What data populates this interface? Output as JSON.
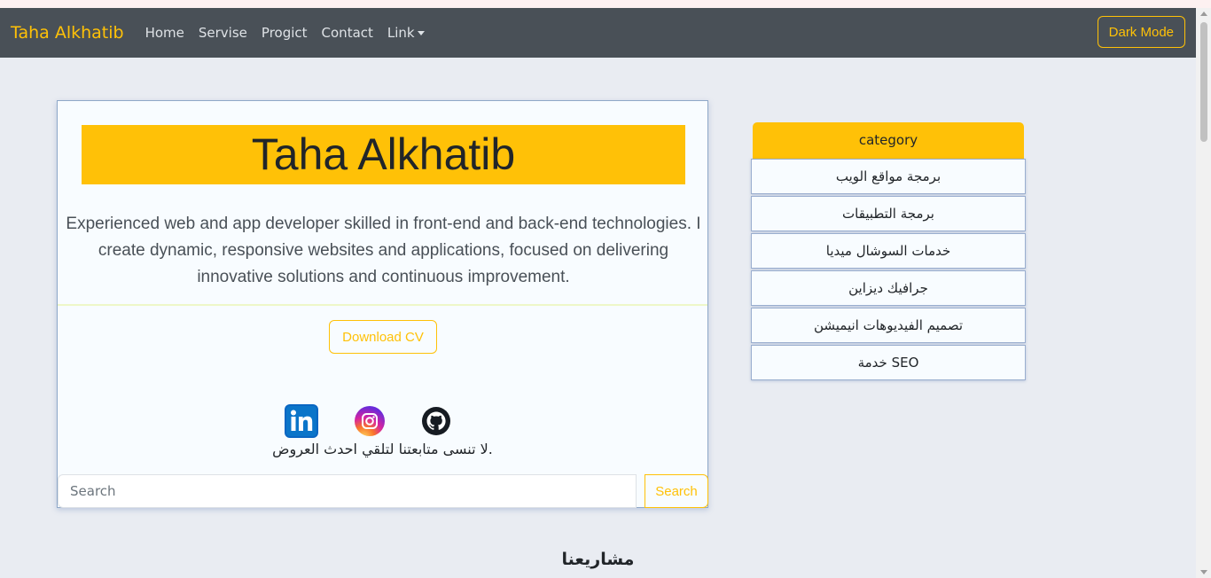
{
  "navbar": {
    "brand": "Taha Alkhatib",
    "links": [
      "Home",
      "Servise",
      "Progict",
      "Contact"
    ],
    "dropdown_label": "Link",
    "dark_mode_label": "Dark Mode"
  },
  "profile": {
    "name": "Taha Alkhatib",
    "bio": "Experienced web and app developer skilled in front-end and back-end technologies. I create dynamic, responsive websites and applications, focused on delivering innovative solutions and continuous improvement.",
    "download_label": "Download CV",
    "social_icons": [
      "linkedin-icon",
      "instagram-icon",
      "github-icon"
    ],
    "follow_text": "لا تنسى متابعتنا لتلقي احدث العروض.",
    "search_placeholder": "Search",
    "search_button": "Search"
  },
  "category": {
    "header": "category",
    "items": [
      "برمجة مواقع الويب",
      "برمجة التطبيقات",
      "خدمات السوشال ميديا",
      "جرافيك ديزاين",
      "تصميم الفيديوهات انيميشن",
      "خدمة SEO"
    ]
  },
  "projects_heading": "مشاريعنا",
  "colors": {
    "accent": "#ffc107",
    "navbar_bg": "#495057",
    "page_bg": "#e9ecf2"
  }
}
